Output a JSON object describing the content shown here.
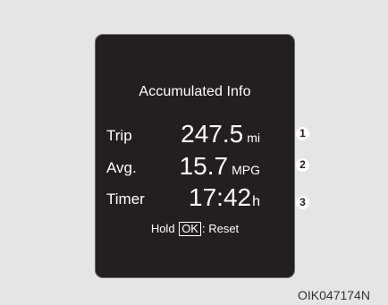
{
  "display": {
    "title": "Accumulated Info",
    "rows": [
      {
        "label": "Trip",
        "value": "247.5",
        "unit": "mi",
        "marker": "1"
      },
      {
        "label": "Avg.",
        "value": "15.7",
        "unit": "MPG",
        "marker": "2"
      },
      {
        "label": "Timer",
        "value": "17:42",
        "unit": "h",
        "marker": "3"
      }
    ],
    "hint": {
      "prefix": "Hold",
      "key": "OK",
      "suffix": ": Reset"
    }
  },
  "caption": "OIK047174N",
  "colors": {
    "screen_background": "#231f20",
    "page_background": "#e5e5e5",
    "text": "#ffffff"
  }
}
